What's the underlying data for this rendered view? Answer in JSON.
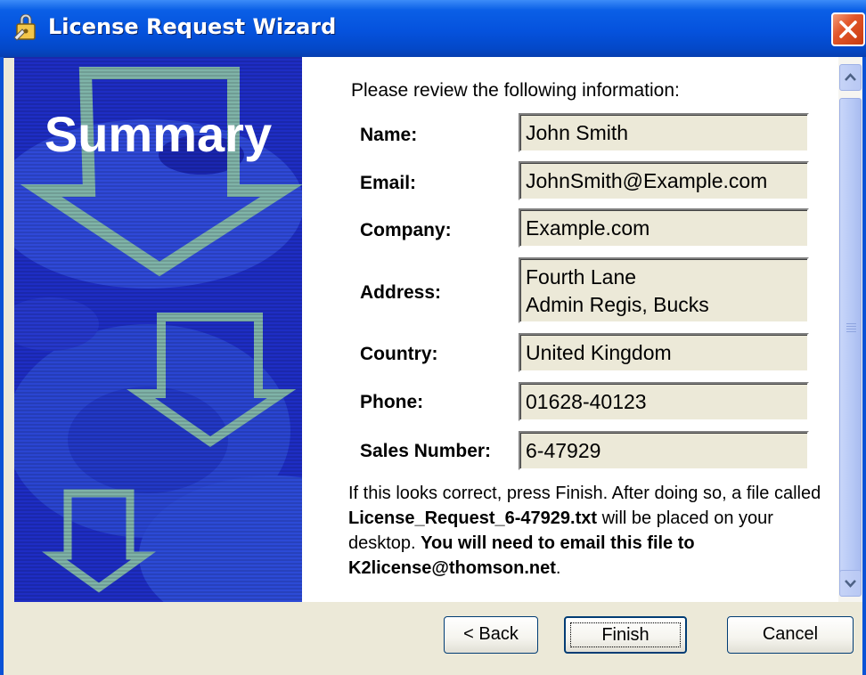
{
  "window": {
    "title": "License Request Wizard"
  },
  "banner": {
    "title": "Summary"
  },
  "content": {
    "intro": "Please review the following information:",
    "fields": [
      {
        "label": "Name:",
        "value": "John Smith"
      },
      {
        "label": "Email:",
        "value": "JohnSmith@Example.com"
      },
      {
        "label": "Company:",
        "value": "Example.com"
      },
      {
        "label": "Address:",
        "value_line1": "Fourth Lane",
        "value_line2": "Admin Regis, Bucks"
      },
      {
        "label": "Country:",
        "value": "United Kingdom"
      },
      {
        "label": "Phone:",
        "value": "01628-40123"
      },
      {
        "label": "Sales Number:",
        "value": "6-47929"
      }
    ],
    "note": {
      "part1": "If this looks correct, press Finish. After doing so, a file called ",
      "filename": "License_Request_6-47929.txt",
      "part2": " will be placed on your desktop. ",
      "emphasis": "You will need to email this file to K2license@thomson.net",
      "part3": "."
    }
  },
  "buttons": {
    "back": "< Back",
    "finish": "Finish",
    "cancel": "Cancel"
  },
  "icons": {
    "title_icon": "wizard-lock-icon",
    "close": "close-icon",
    "scroll_up": "chevron-up-icon",
    "scroll_down": "chevron-down-icon"
  },
  "colors": {
    "titlebar": "#0552dd",
    "banner": "#1e2dc4",
    "close": "#e2562a",
    "arrow": "#7fb3a8",
    "field_bg": "#ece9d8"
  }
}
